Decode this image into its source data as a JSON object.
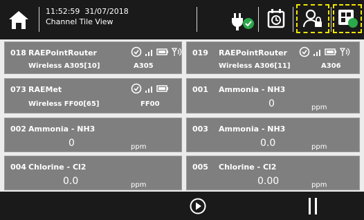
{
  "header": {
    "time": "11:52:59",
    "date": "31/07/2018",
    "view_title": "Channel Tile View",
    "selection_color": "#f3e600",
    "status_ok_color": "#2ba84a"
  },
  "tiles": [
    {
      "id": "018",
      "name": "RAEPointRouter",
      "sub": "Wireless A305[10]",
      "code": "A305",
      "value": "",
      "unit": ""
    },
    {
      "id": "019",
      "name": "RAEPointRouter",
      "sub": "Wireless A306[11]",
      "code": "A306",
      "value": "",
      "unit": ""
    },
    {
      "id": "073",
      "name": "RAEMet",
      "sub": "Wireless FF00[65]",
      "code": "FF00",
      "value": "",
      "unit": ""
    },
    {
      "id": "001",
      "name": "Ammonia - NH3",
      "sub": "",
      "code": "",
      "value": "0",
      "unit": "ppm"
    },
    {
      "id": "002",
      "name": "Ammonia - NH3",
      "sub": "",
      "code": "",
      "value": "0",
      "unit": "ppm"
    },
    {
      "id": "003",
      "name": "Ammonia - NH3",
      "sub": "",
      "code": "",
      "value": "0.0",
      "unit": "ppm"
    },
    {
      "id": "004",
      "name": "Chlorine - Cl2",
      "sub": "",
      "code": "",
      "value": "0.0",
      "unit": "ppm"
    },
    {
      "id": "005",
      "name": "Chlorine - Cl2",
      "sub": "",
      "code": "",
      "value": "0.00",
      "unit": "ppm"
    }
  ],
  "icons": {
    "home": "home-icon",
    "power": "power-plug-icon",
    "calendar": "calendar-clock-icon",
    "user": "user-lock-icon",
    "grid": "tile-grid-icon",
    "check": "check-circle-icon",
    "signal": "signal-bars-icon",
    "battery": "battery-icon",
    "antenna": "antenna-icon",
    "next": "next-arrow-icon",
    "pause": "pause-icon"
  }
}
